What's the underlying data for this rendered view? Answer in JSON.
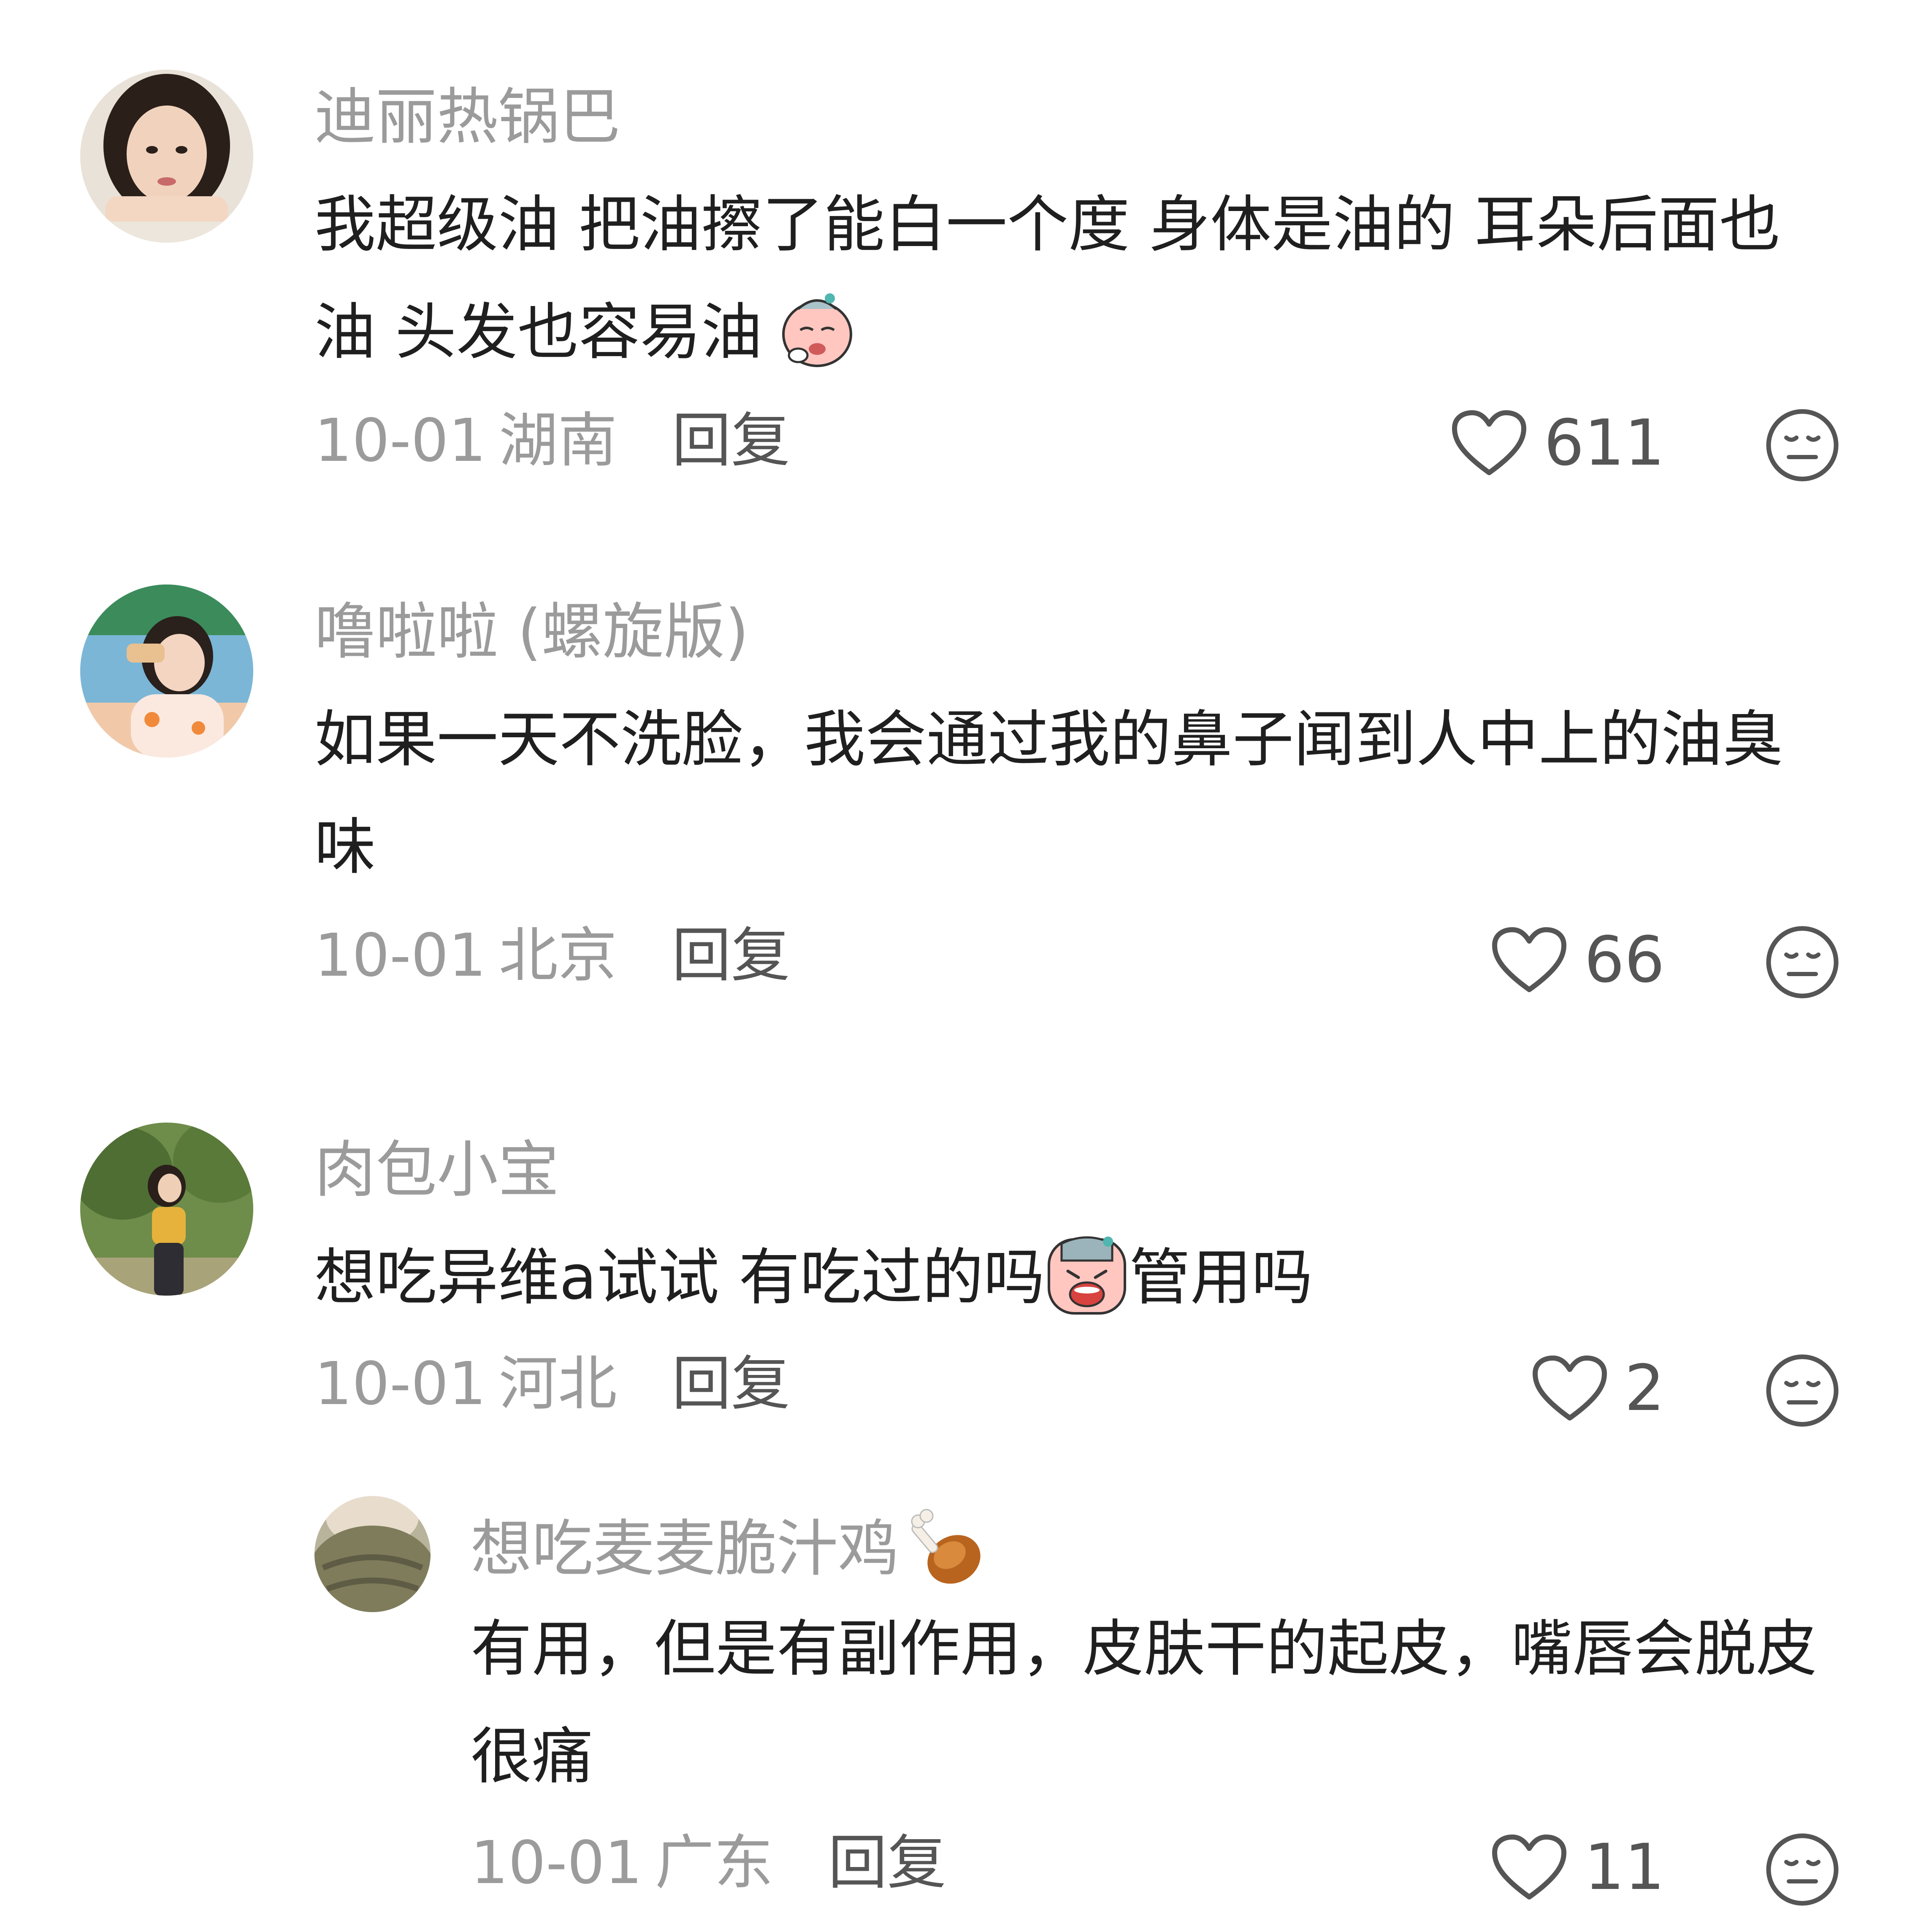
{
  "comments": [
    {
      "username": "迪丽热锅巴",
      "body": "我超级油 把油擦了能白一个度 身体是油的 耳朵后面也油 头发也容易油",
      "emoji": "sick-face-emoji",
      "date": "10-01",
      "region": "湖南",
      "reply_label": "回复",
      "likes": "611"
    },
    {
      "username": "噜啦啦 (螺旋版)",
      "body": "如果一天不洗脸，我会通过我的鼻子闻到人中上的油臭味",
      "date": "10-01",
      "region": "北京",
      "reply_label": "回复",
      "likes": "66"
    },
    {
      "username": "肉包小宝",
      "body_before": "想吃异维a试试  有吃过的吗",
      "emoji": "crying-face-emoji",
      "body_after": "管用吗",
      "date": "10-01",
      "region": "河北",
      "reply_label": "回复",
      "likes": "2"
    },
    {
      "username": "想吃麦麦脆汁鸡",
      "username_emoji": "chicken-leg-emoji",
      "body": "有用，但是有副作用，皮肤干的起皮，嘴唇会脱皮很痛",
      "date": "10-01",
      "region": "广东",
      "reply_label": "回复",
      "likes": "11"
    }
  ],
  "icons": {
    "like": "heart-outline-icon",
    "react": "neutral-face-icon"
  }
}
